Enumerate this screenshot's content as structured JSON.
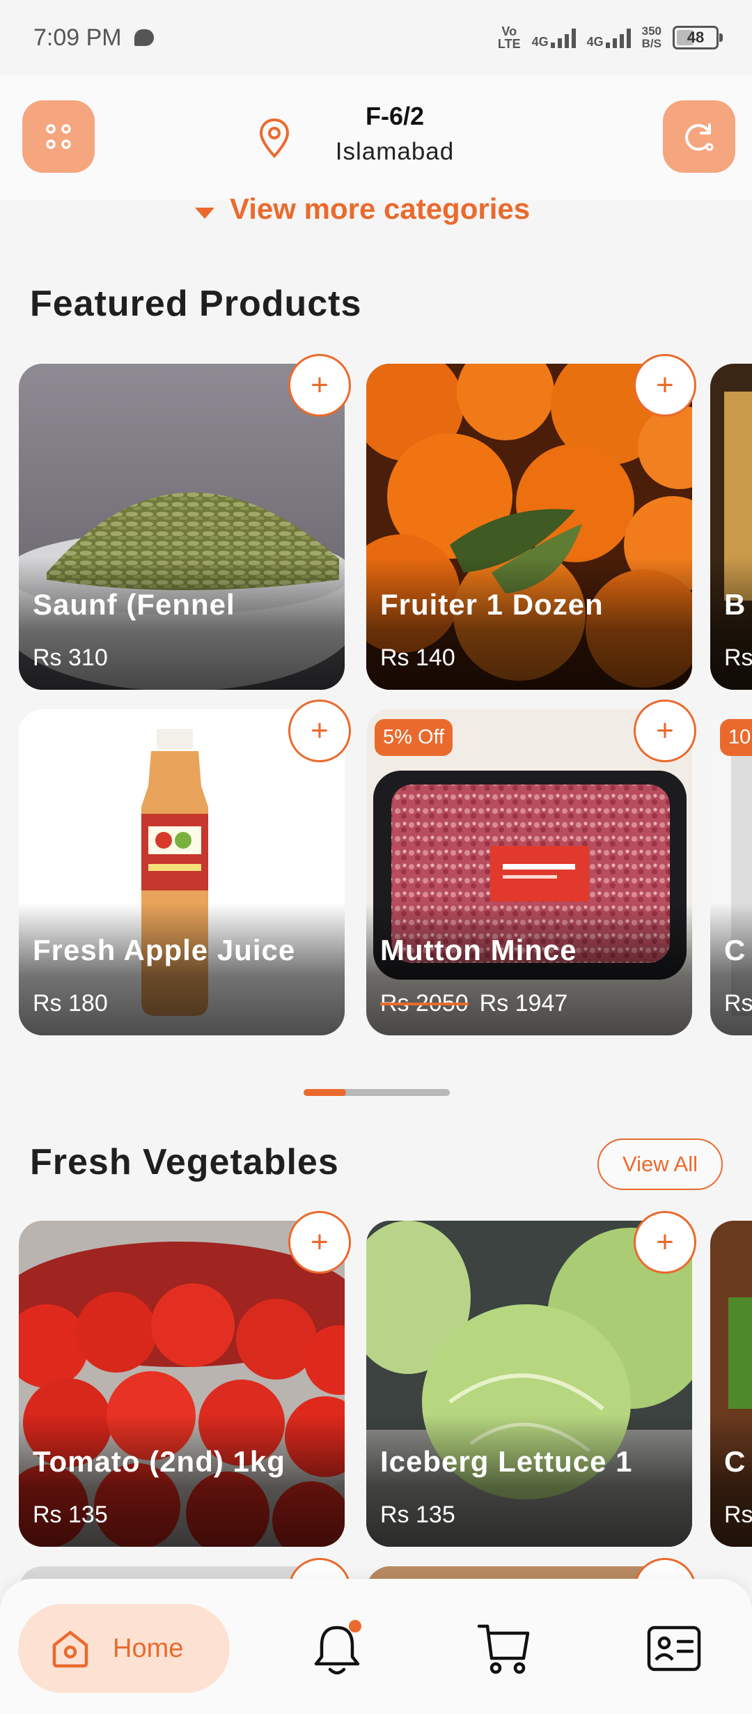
{
  "status_bar": {
    "time": "7:09 PM",
    "net1": [
      "Vo",
      "LTE"
    ],
    "net2_top": "4G",
    "net3_top": "4G",
    "speed": [
      "350",
      "B/S"
    ],
    "battery": "48"
  },
  "header": {
    "location_area": "F-6/2",
    "location_city": "Islamabad"
  },
  "view_more_label": "View more categories",
  "featured": {
    "title": "Featured Products",
    "products": [
      {
        "name": "Saunf (Fennel",
        "price": "Rs 310"
      },
      {
        "name": "Fruiter 1 Dozen",
        "price": "Rs 140"
      },
      {
        "name": "B",
        "price": "Rs"
      },
      {
        "name": "Fresh Apple Juice",
        "price": "Rs 180"
      },
      {
        "name": "Mutton Mince",
        "old_price": "Rs 2050",
        "price": "Rs 1947",
        "badge": "5% Off"
      },
      {
        "name": "C",
        "price": "Rs",
        "badge": "10"
      }
    ]
  },
  "vegetables": {
    "title": "Fresh Vegetables",
    "view_all": "View All",
    "products": [
      {
        "name": "Tomato (2nd) 1kg",
        "price": "Rs 135"
      },
      {
        "name": "Iceberg Lettuce 1",
        "price": "Rs 135"
      },
      {
        "name": "C",
        "price": "Rs"
      }
    ]
  },
  "add_label": "+",
  "pager": {
    "current_fraction": 0.29
  },
  "nav": {
    "home_label": "Home",
    "items": [
      "home-icon",
      "bell-icon",
      "cart-icon",
      "profile-card-icon"
    ]
  },
  "colors": {
    "accent": "#ea6a2d",
    "accent_light": "#f5a67f",
    "background": "#f5f5f5"
  }
}
